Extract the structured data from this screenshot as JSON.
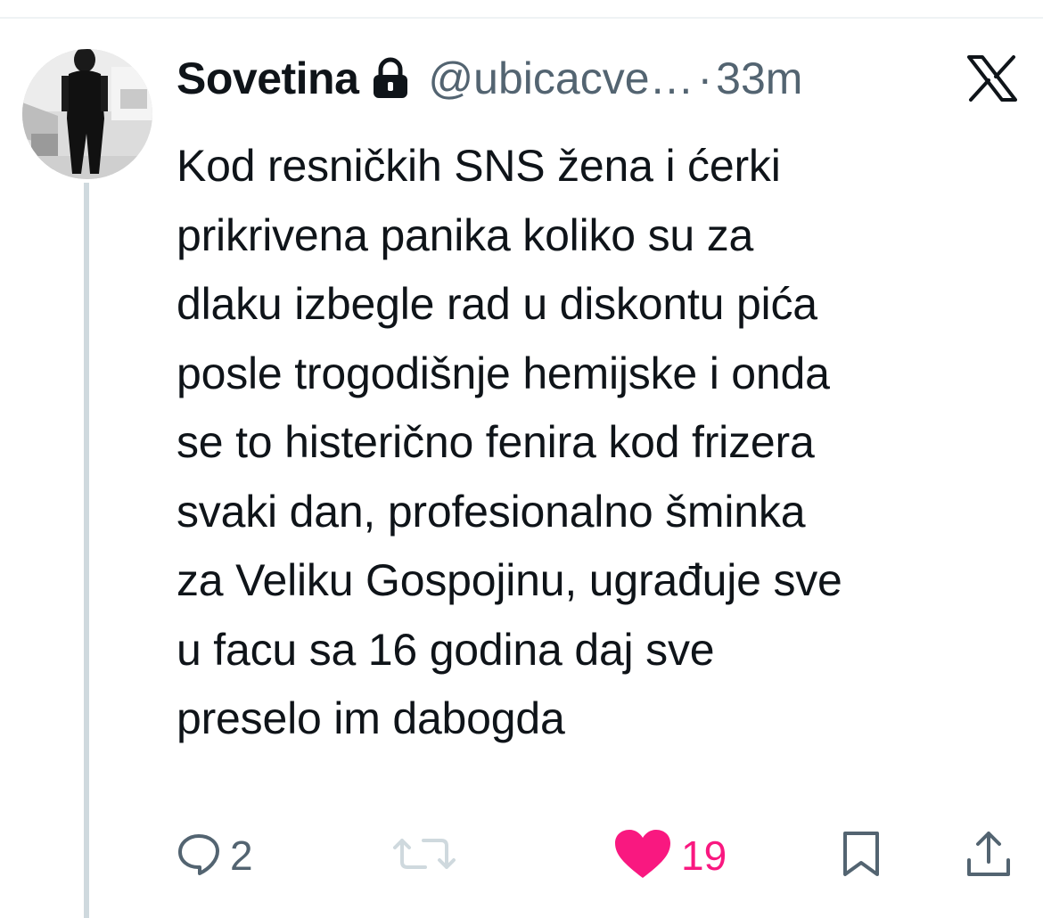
{
  "tweet": {
    "author": {
      "display_name": "Sovetina",
      "handle": "@ubicacve…",
      "protected": true
    },
    "separator": "·",
    "time": "33m",
    "platform": "X",
    "text": "Kod resničkih SNS žena i ćerki\nprikrivena panika koliko su za\ndlaku izbegle rad u diskontu pića\nposle trogodišnje hemijske i onda\nse to histerično fenira kod frizera\nsvaki dan, profesionalno šminka\nza Veliku Gospojinu, ugrađuje sve\nu facu sa 16 godina daj sve\npreselo im dabogda",
    "metrics": {
      "replies": "2",
      "likes": "19"
    },
    "liked": true,
    "colors": {
      "like": "#f91880",
      "muted": "#536471",
      "text": "#0f1419",
      "retweet_disabled": "#cfd9de"
    },
    "icons": [
      "reply-icon",
      "retweet-icon",
      "heart-icon",
      "bookmark-icon",
      "share-icon",
      "lock-icon",
      "x-logo-icon"
    ]
  }
}
